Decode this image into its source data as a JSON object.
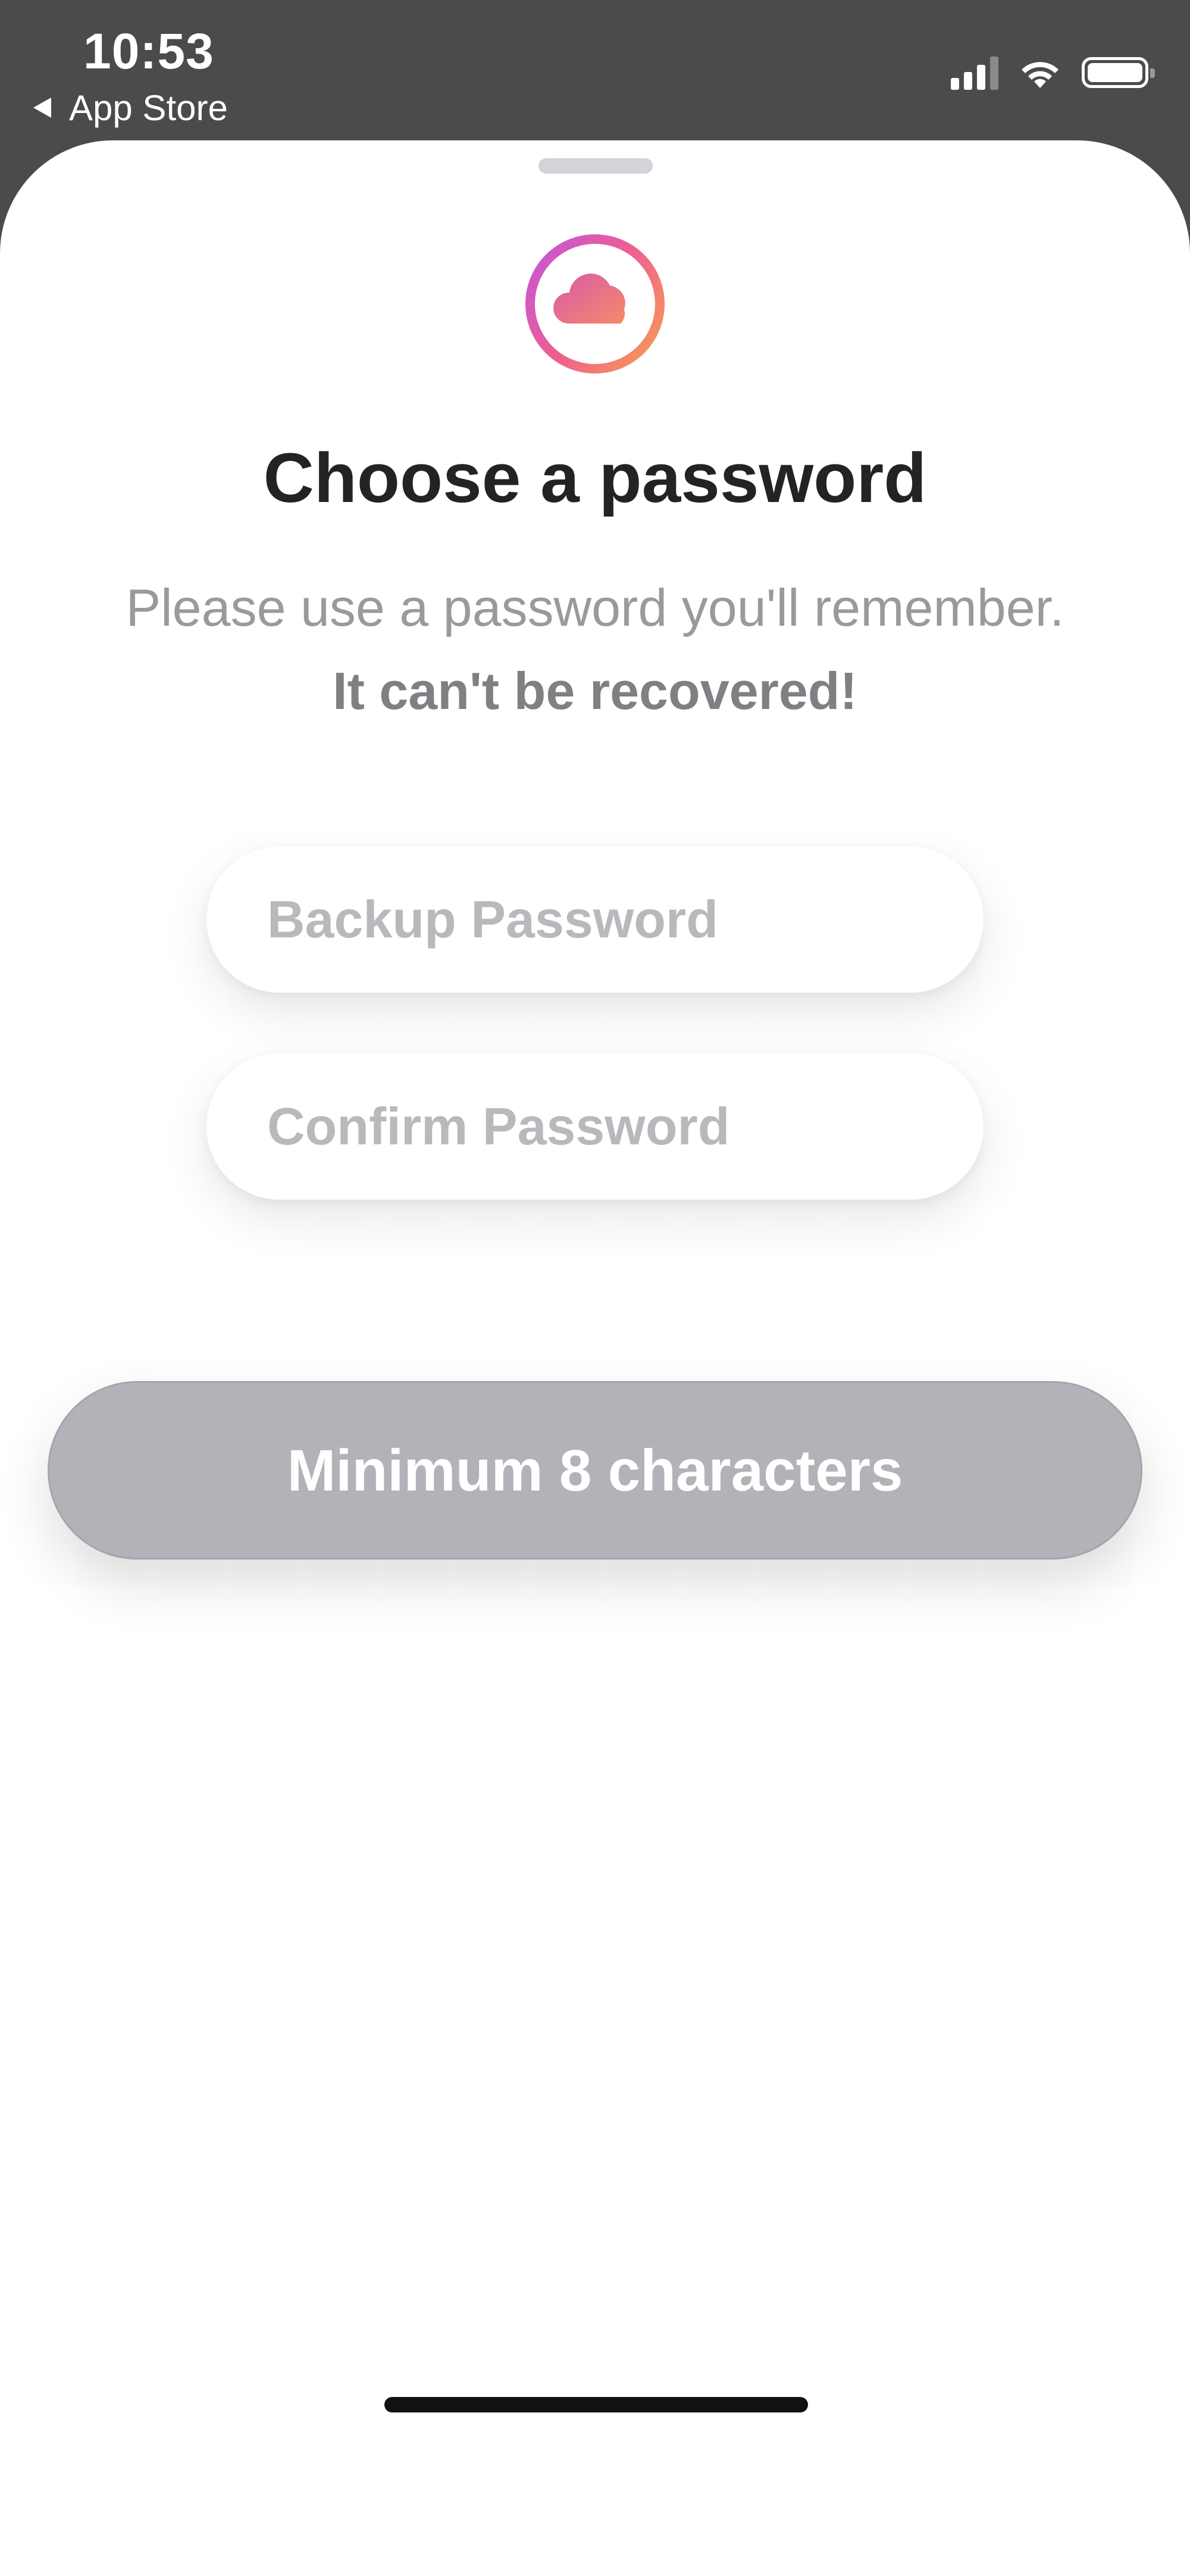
{
  "status_bar": {
    "time": "10:53",
    "back_label": "App Store",
    "icons": [
      "signal-icon",
      "wifi-icon",
      "battery-icon"
    ]
  },
  "sheet": {
    "logo_icon": "cloud-icon",
    "title": "Choose a password",
    "subtitle_regular": "Please use a password you'll remember.",
    "subtitle_emphasis": "It can't be recovered!",
    "fields": {
      "backup_placeholder": "Backup Password",
      "confirm_placeholder": "Confirm Password"
    },
    "button_label": "Minimum 8 characters",
    "button_state": "disabled"
  },
  "colors": {
    "button_disabled": "#b1b3b8",
    "logo_gradient": [
      "#c055e0",
      "#ef5f8f",
      "#f6a44c"
    ]
  }
}
